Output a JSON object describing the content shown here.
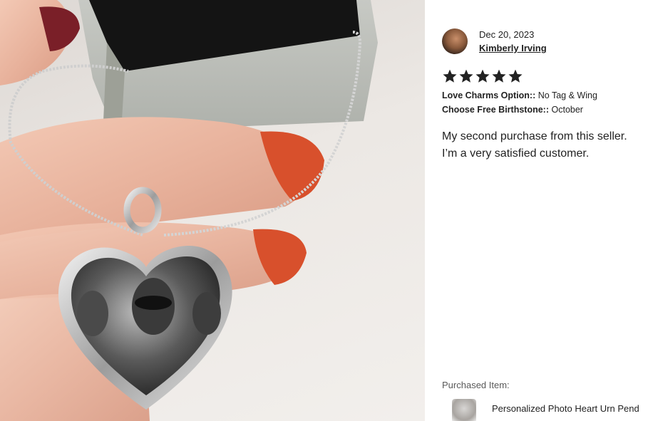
{
  "review": {
    "date": "Dec 20, 2023",
    "reviewer_name": "Kimberly Irving",
    "rating": 5,
    "options": [
      {
        "label": "Love Charms Option::",
        "value": "No Tag & Wing"
      },
      {
        "label": "Choose Free Birthstone::",
        "value": "October"
      }
    ],
    "text_line1": "My second purchase from this seller.",
    "text_line2": "I’m a very satisfied customer."
  },
  "purchased": {
    "label": "Purchased Item:",
    "item_title": "Personalized Photo Heart Urn Pend"
  },
  "colors": {
    "star": "#222222",
    "text": "#222222",
    "muted": "#595959",
    "nail": "#d8502c",
    "box_lining": "#141414"
  }
}
